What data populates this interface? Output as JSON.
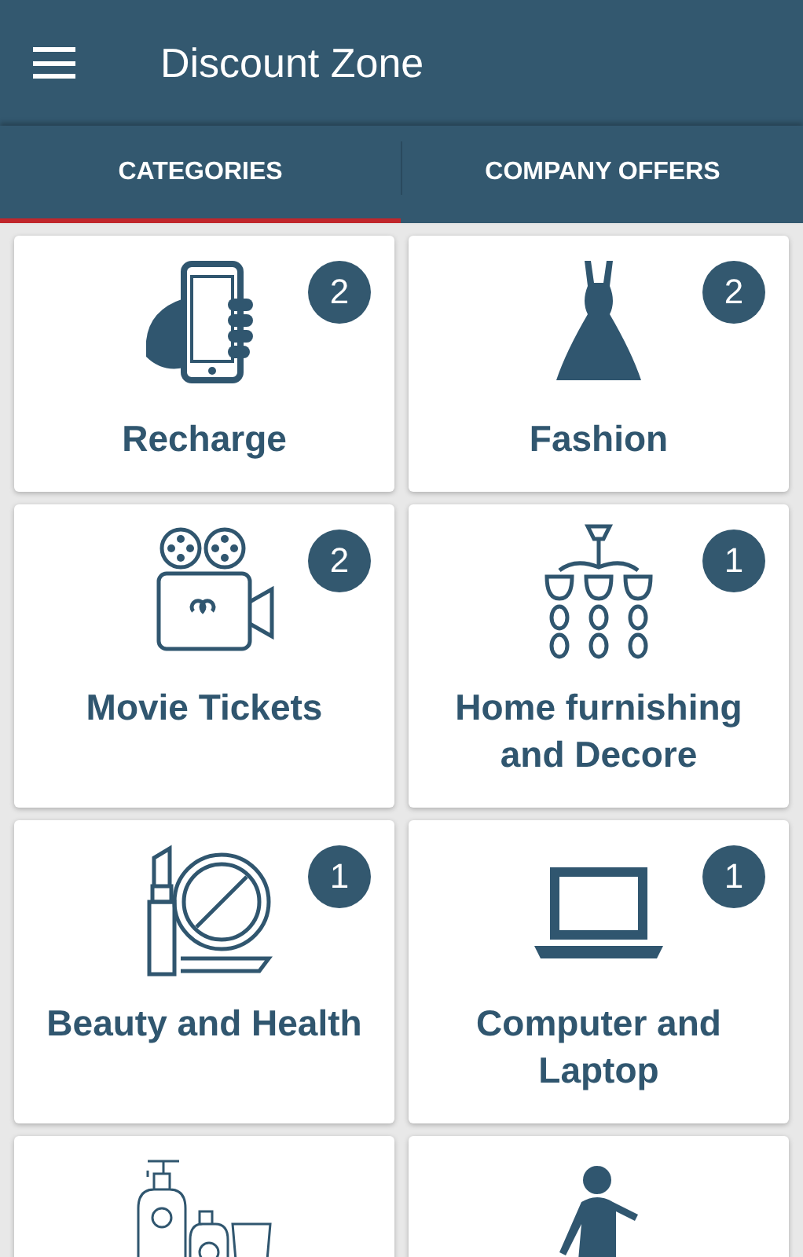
{
  "app_bar": {
    "title": "Discount Zone"
  },
  "tabs": [
    {
      "label": "CATEGORIES",
      "selected": true
    },
    {
      "label": "COMPANY OFFERS",
      "selected": false
    }
  ],
  "categories": [
    {
      "kind": "full",
      "label": "Recharge",
      "count": "2"
    },
    {
      "kind": "full",
      "label": "Fashion",
      "count": "2"
    },
    {
      "kind": "full",
      "label": "Movie Tickets",
      "count": "2"
    },
    {
      "kind": "full",
      "label": "Home furnishing and Decore",
      "count": "1"
    },
    {
      "kind": "full",
      "label": "Beauty and Health",
      "count": "1"
    },
    {
      "kind": "full",
      "label": "Computer and Laptop",
      "count": "1"
    },
    {
      "kind": "partial"
    },
    {
      "kind": "partial"
    }
  ]
}
